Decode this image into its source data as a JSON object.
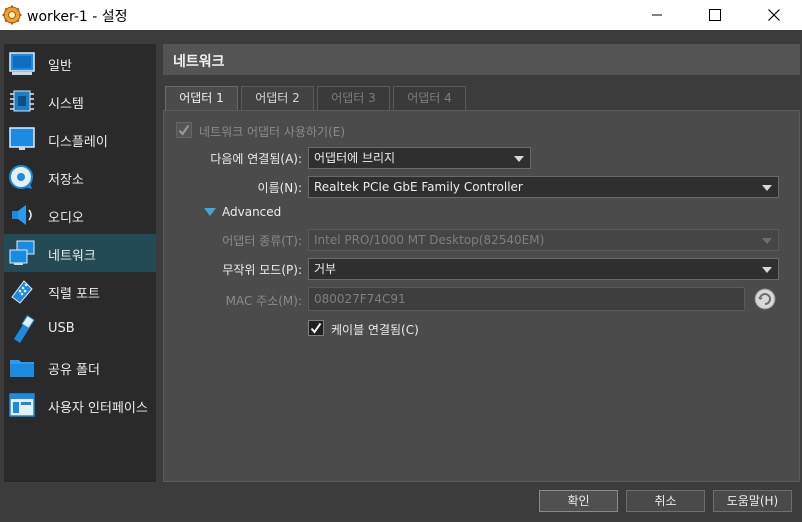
{
  "window": {
    "title": "worker-1 - 설정"
  },
  "sidebar": {
    "items": [
      {
        "label": "일반",
        "icon": "general-icon"
      },
      {
        "label": "시스템",
        "icon": "system-chip-icon"
      },
      {
        "label": "디스플레이",
        "icon": "display-monitor-icon"
      },
      {
        "label": "저장소",
        "icon": "storage-disk-icon"
      },
      {
        "label": "오디오",
        "icon": "audio-speaker-icon"
      },
      {
        "label": "네트워크",
        "icon": "network-icon",
        "active": true
      },
      {
        "label": "직렬 포트",
        "icon": "serial-port-icon"
      },
      {
        "label": "USB",
        "icon": "usb-icon"
      },
      {
        "label": "공유 폴더",
        "icon": "shared-folder-icon"
      },
      {
        "label": "사용자 인터페이스",
        "icon": "user-interface-icon"
      }
    ]
  },
  "main": {
    "title": "네트워크",
    "tabs": [
      {
        "label": "어댑터 1",
        "active": true
      },
      {
        "label": "어댑터 2"
      },
      {
        "label": "어댑터 3"
      },
      {
        "label": "어댑터 4"
      }
    ]
  },
  "form": {
    "enable_adapter_label": "네트워크 어댑터 사용하기(E)",
    "attached_to_label": "다음에 연결됨(A):",
    "attached_to_value": "어댑터에 브리지",
    "name_label": "이름(N):",
    "name_value": "Realtek PCIe GbE Family Controller",
    "advanced_label": "Advanced",
    "adapter_type_label": "어댑터 종류(T):",
    "adapter_type_value": "Intel PRO/1000 MT Desktop(82540EM)",
    "promiscuous_label": "무작위 모드(P):",
    "promiscuous_value": "거부",
    "mac_label": "MAC 주소(M):",
    "mac_value": "080027F74C91",
    "cable_connected_label": "케이블 연결됨(C)"
  },
  "buttons": {
    "ok": "확인",
    "cancel": "취소",
    "help": "도움말(H)"
  },
  "colors": {
    "accent": "#3fa6e0",
    "active_sidebar": "#234a55"
  }
}
